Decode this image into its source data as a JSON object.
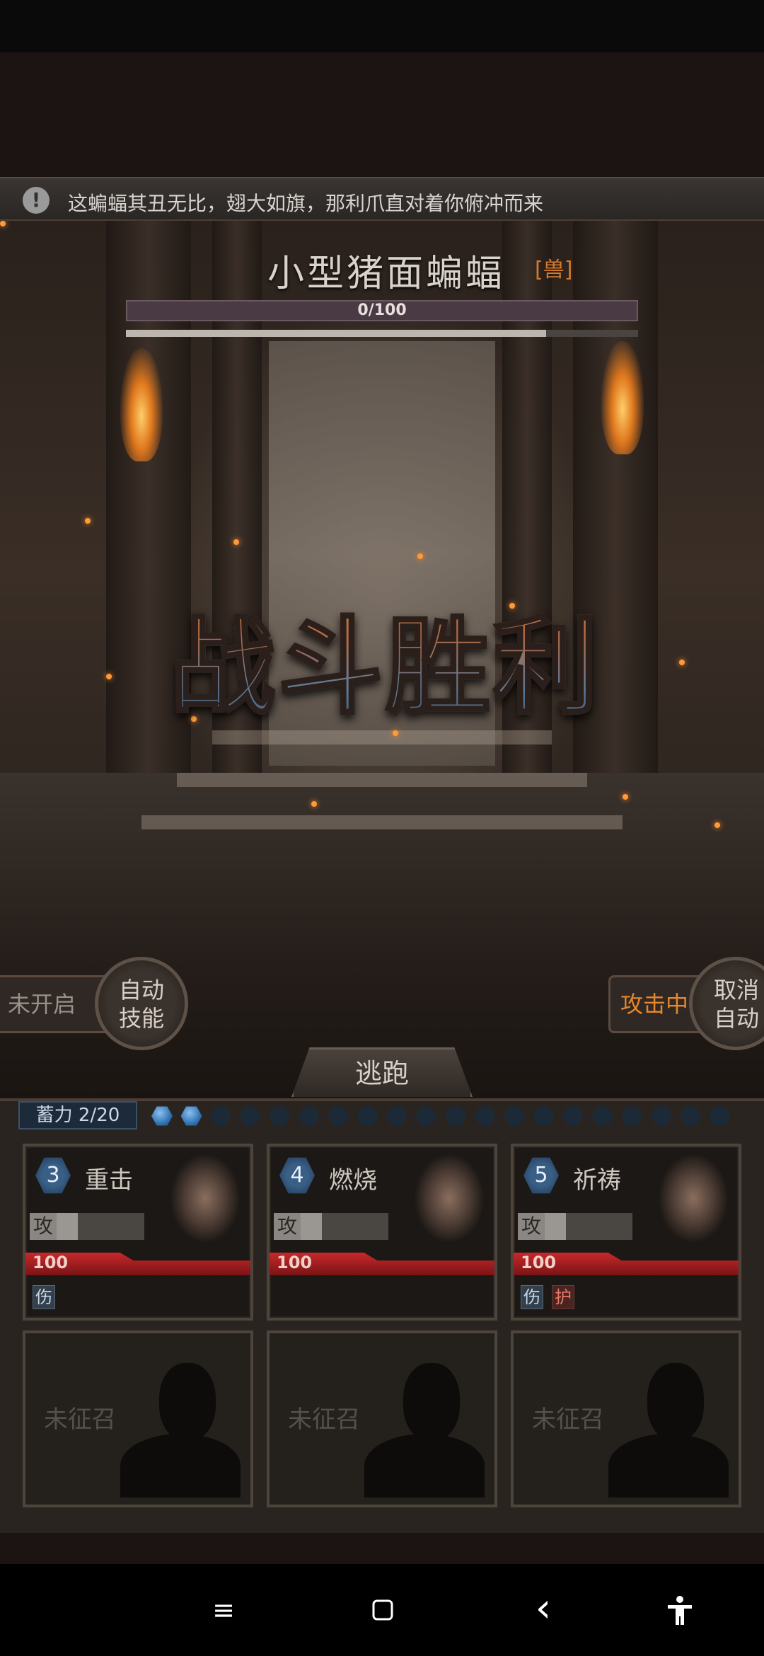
{
  "notice": {
    "icon": "alert-icon",
    "text": "这蝙蝠其丑无比，翅大如旗，那利爪直对着你俯冲而来"
  },
  "enemy": {
    "name": "小型猪面蝙蝠",
    "type": "[兽]",
    "hp_text": "0/100",
    "sub_bar_fill": 0.82
  },
  "result": {
    "text": "战斗胜利"
  },
  "controls": {
    "auto_skill_status": "未开启",
    "auto_skill_button": [
      "自动",
      "技能"
    ],
    "attack_status": "攻击中",
    "cancel_auto_button": [
      "取消",
      "自动"
    ],
    "flee_button": "逃跑"
  },
  "charge": {
    "label": "蓄力 2/20",
    "current": 2,
    "max": 20
  },
  "characters": [
    {
      "level": "3",
      "skill": "重击",
      "attack_label": "攻",
      "hp": "100",
      "tags": [
        "伤"
      ]
    },
    {
      "level": "4",
      "skill": "燃烧",
      "attack_label": "攻",
      "hp": "100",
      "tags": []
    },
    {
      "level": "5",
      "skill": "祈祷",
      "attack_label": "攻",
      "hp": "100",
      "tags": [
        "伤",
        "护"
      ]
    }
  ],
  "empty_slots": [
    {
      "text": "未征召"
    },
    {
      "text": "未征召"
    },
    {
      "text": "未征召"
    }
  ],
  "nav": {
    "menu_icon": "≡",
    "home_icon": "▢",
    "back_icon": "‹",
    "accessibility_icon": "accessibility-icon"
  }
}
